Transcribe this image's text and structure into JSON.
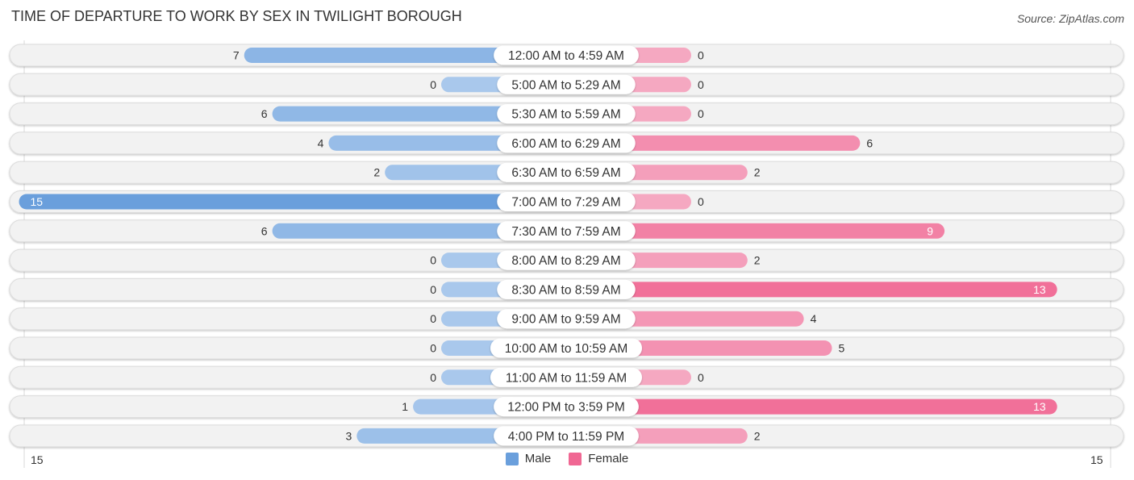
{
  "header": {
    "title": "TIME OF DEPARTURE TO WORK BY SEX IN TWILIGHT BOROUGH",
    "source": "Source: ZipAtlas.com"
  },
  "colors": {
    "male_strong": "#6a9fdc",
    "male_light": "#a9c8ec",
    "female_strong": "#f06793",
    "female_light": "#f5a8c1",
    "track": "#f2f2f2"
  },
  "legend": {
    "male_label": "Male",
    "female_label": "Female"
  },
  "axis": {
    "left_max_label": "15",
    "right_max_label": "15"
  },
  "chart_data": {
    "type": "bar",
    "orientation": "horizontal-diverging",
    "title": "TIME OF DEPARTURE TO WORK BY SEX IN TWILIGHT BOROUGH",
    "categories": [
      "12:00 AM to 4:59 AM",
      "5:00 AM to 5:29 AM",
      "5:30 AM to 5:59 AM",
      "6:00 AM to 6:29 AM",
      "6:30 AM to 6:59 AM",
      "7:00 AM to 7:29 AM",
      "7:30 AM to 7:59 AM",
      "8:00 AM to 8:29 AM",
      "8:30 AM to 8:59 AM",
      "9:00 AM to 9:59 AM",
      "10:00 AM to 10:59 AM",
      "11:00 AM to 11:59 AM",
      "12:00 PM to 3:59 PM",
      "4:00 PM to 11:59 PM"
    ],
    "series": [
      {
        "name": "Male",
        "values": [
          7,
          0,
          6,
          4,
          2,
          15,
          6,
          0,
          0,
          0,
          0,
          0,
          1,
          3
        ]
      },
      {
        "name": "Female",
        "values": [
          0,
          0,
          0,
          6,
          2,
          0,
          9,
          2,
          13,
          4,
          5,
          0,
          13,
          2
        ]
      }
    ],
    "xlim": [
      -15,
      15
    ],
    "tick_labels": [
      "15",
      "15"
    ],
    "legend_position": "bottom-center",
    "grid": false
  }
}
